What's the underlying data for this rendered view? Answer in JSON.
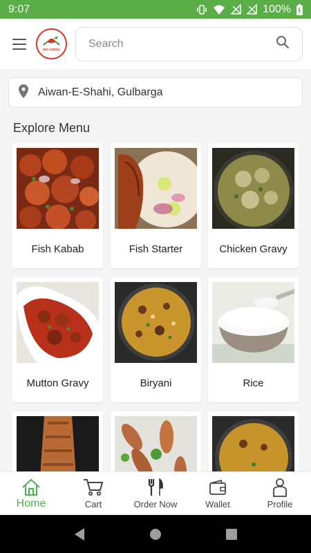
{
  "status_bar": {
    "time": "9:07",
    "battery": "100%"
  },
  "header": {
    "logo_text": "RIG DINING",
    "search_placeholder": "Search"
  },
  "location": {
    "text": "Aiwan-E-Shahi, Gulbarga"
  },
  "section_title": "Explore Menu",
  "menu_items": [
    {
      "label": "Fish Kabab"
    },
    {
      "label": "Fish Starter"
    },
    {
      "label": "Chicken Gravy"
    },
    {
      "label": "Mutton Gravy"
    },
    {
      "label": "Biryani"
    },
    {
      "label": "Rice"
    },
    {
      "label": ""
    },
    {
      "label": ""
    },
    {
      "label": ""
    }
  ],
  "bottom_nav": [
    {
      "label": "Home",
      "icon": "home-icon",
      "active": true
    },
    {
      "label": "Cart",
      "icon": "cart-icon"
    },
    {
      "label": "Order Now",
      "icon": "fork-knife-icon"
    },
    {
      "label": "Wallet",
      "icon": "wallet-icon"
    },
    {
      "label": "Profile",
      "icon": "profile-icon"
    }
  ],
  "colors": {
    "accent": "#5aad47",
    "active_nav": "#4caf50"
  }
}
